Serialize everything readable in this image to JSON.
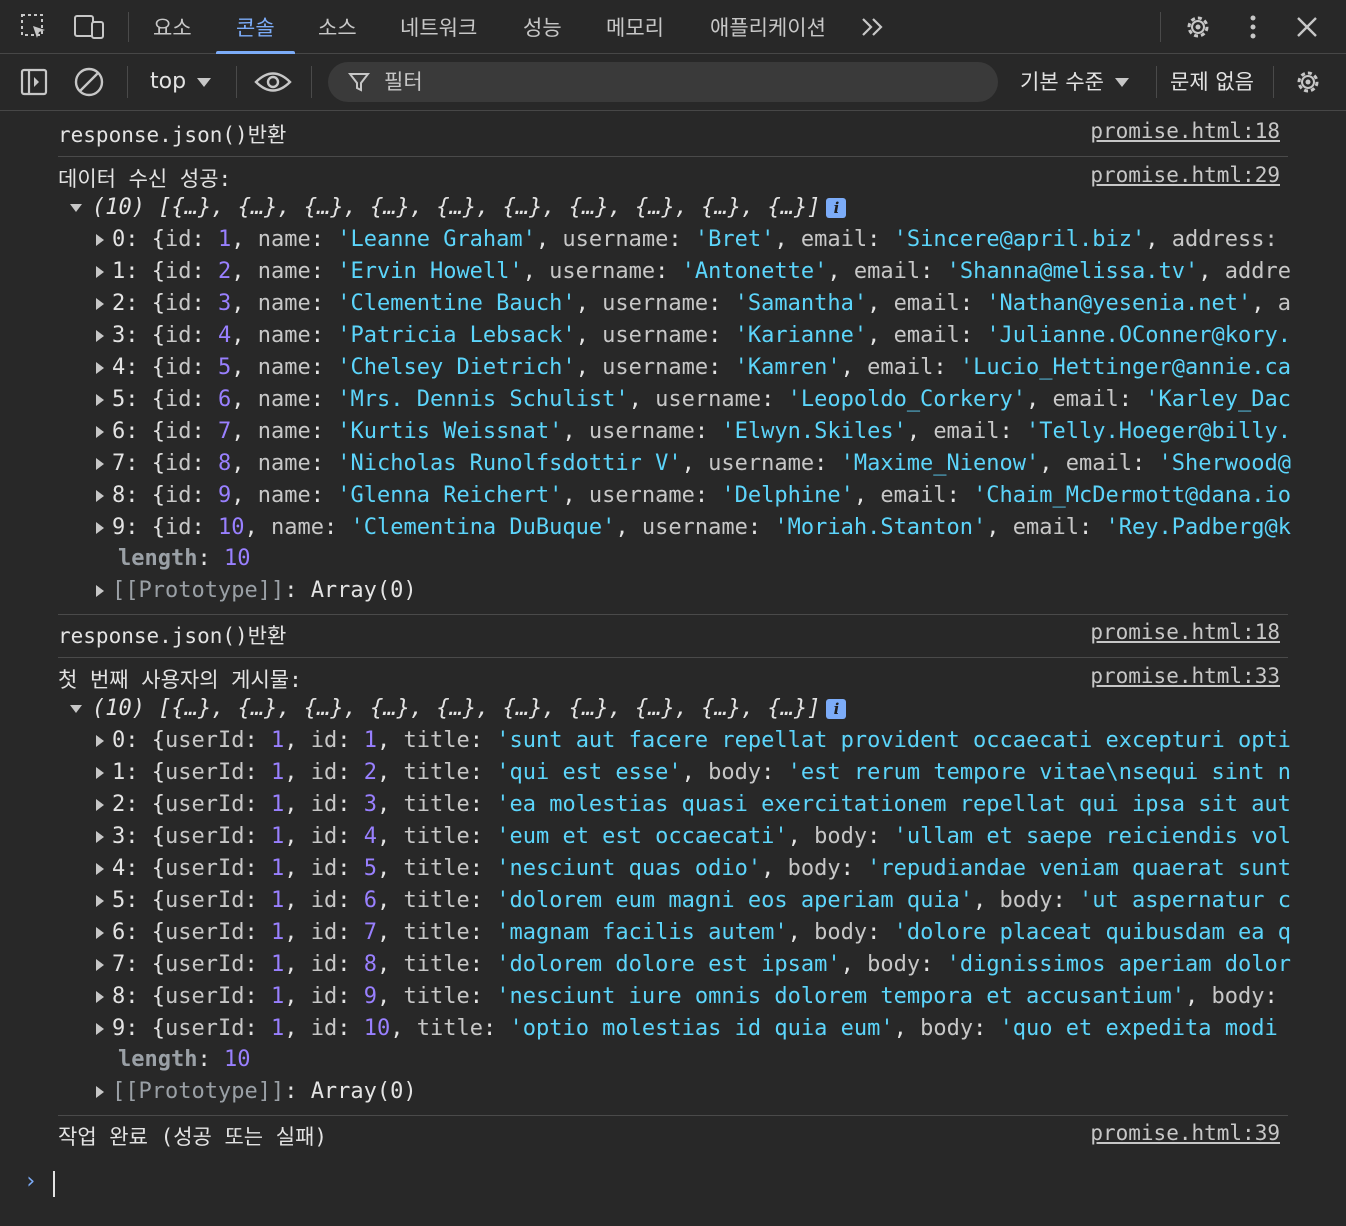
{
  "tabs": [
    {
      "label": "요소",
      "active": false
    },
    {
      "label": "콘솔",
      "active": true
    },
    {
      "label": "소스",
      "active": false
    },
    {
      "label": "네트워크",
      "active": false
    },
    {
      "label": "성능",
      "active": false
    },
    {
      "label": "메모리",
      "active": false
    },
    {
      "label": "애플리케이션",
      "active": false
    }
  ],
  "toolbar": {
    "context": "top",
    "filter_placeholder": "필터",
    "levels": "기본 수준",
    "issues": "문제 없음"
  },
  "console": {
    "messages": [
      {
        "text": "response.json()반환",
        "source": "promise.html:18"
      },
      {
        "text": "데이터 수신 성공:",
        "source": "promise.html:29"
      },
      {
        "text": "response.json()반환",
        "source": "promise.html:18"
      },
      {
        "text": "첫 번째 사용자의 게시물:",
        "source": "promise.html:33"
      },
      {
        "text": "작업 완료 (성공 또는 실패)",
        "source": "promise.html:39"
      }
    ],
    "users_summary": "(10) [{…}, {…}, {…}, {…}, {…}, {…}, {…}, {…}, {…}, {…}]",
    "posts_summary": "(10) [{…}, {…}, {…}, {…}, {…}, {…}, {…}, {…}, {…}, {…}]",
    "users": [
      {
        "index": "0",
        "id": "1",
        "name": "'Leanne Graham'",
        "username": "'Bret'",
        "email": "'Sincere@april.biz'",
        "tail": "address:"
      },
      {
        "index": "1",
        "id": "2",
        "name": "'Ervin Howell'",
        "username": "'Antonette'",
        "email": "'Shanna@melissa.tv'",
        "tail": "addre"
      },
      {
        "index": "2",
        "id": "3",
        "name": "'Clementine Bauch'",
        "username": "'Samantha'",
        "email": "'Nathan@yesenia.net'",
        "tail": "a"
      },
      {
        "index": "3",
        "id": "4",
        "name": "'Patricia Lebsack'",
        "username": "'Karianne'",
        "email": "'Julianne.OConner@kory.org'",
        "tail": ""
      },
      {
        "index": "4",
        "id": "5",
        "name": "'Chelsey Dietrich'",
        "username": "'Kamren'",
        "email": "'Lucio_Hettinger@annie.ca'",
        "tail": ""
      },
      {
        "index": "5",
        "id": "6",
        "name": "'Mrs. Dennis Schulist'",
        "username": "'Leopoldo_Corkery'",
        "email": "'Karley_Dach@jasper.info'",
        "tail": ""
      },
      {
        "index": "6",
        "id": "7",
        "name": "'Kurtis Weissnat'",
        "username": "'Elwyn.Skiles'",
        "email": "'Telly.Hoeger@billy.biz'",
        "tail": ""
      },
      {
        "index": "7",
        "id": "8",
        "name": "'Nicholas Runolfsdottir V'",
        "username": "'Maxime_Nienow'",
        "email": "'Sherwood@rosamond.me'",
        "tail": ""
      },
      {
        "index": "8",
        "id": "9",
        "name": "'Glenna Reichert'",
        "username": "'Delphine'",
        "email": "'Chaim_McDermott@dana.io'",
        "tail": ""
      },
      {
        "index": "9",
        "id": "10",
        "name": "'Clementina DuBuque'",
        "username": "'Moriah.Stanton'",
        "email": "'Rey.Padberg@karina.biz'",
        "tail": ""
      }
    ],
    "posts": [
      {
        "index": "0",
        "userId": "1",
        "id": "1",
        "title": "'sunt aut facere repellat provident occaecati excepturi optio reprehenderit'",
        "body": ""
      },
      {
        "index": "1",
        "userId": "1",
        "id": "2",
        "title": "'qui est esse'",
        "body": "'est rerum tempore vitae\\nsequi sint nihil'"
      },
      {
        "index": "2",
        "userId": "1",
        "id": "3",
        "title": "'ea molestias quasi exercitationem repellat qui ipsa sit aut'",
        "body": ""
      },
      {
        "index": "3",
        "userId": "1",
        "id": "4",
        "title": "'eum et est occaecati'",
        "body": "'ullam et saepe reiciendis voluptatem'"
      },
      {
        "index": "4",
        "userId": "1",
        "id": "5",
        "title": "'nesciunt quas odio'",
        "body": "'repudiandae veniam quaerat sunt sed'"
      },
      {
        "index": "5",
        "userId": "1",
        "id": "6",
        "title": "'dolorem eum magni eos aperiam quia'",
        "body": "'ut aspernatur corporis'"
      },
      {
        "index": "6",
        "userId": "1",
        "id": "7",
        "title": "'magnam facilis autem'",
        "body": "'dolore placeat quibusdam ea quo'"
      },
      {
        "index": "7",
        "userId": "1",
        "id": "8",
        "title": "'dolorem dolore est ipsam'",
        "body": "'dignissimos aperiam dolorem'"
      },
      {
        "index": "8",
        "userId": "1",
        "id": "9",
        "title": "'nesciunt iure omnis dolorem tempora et accusantium'",
        "body": "body:"
      },
      {
        "index": "9",
        "userId": "1",
        "id": "10",
        "title": "'optio molestias id quia eum'",
        "body": "'quo et expedita modi cum'"
      }
    ],
    "length_label": "length",
    "length_value": "10",
    "prototype": "[[Prototype]]",
    "prototype_value": "Array(0)",
    "prompt": "›"
  }
}
